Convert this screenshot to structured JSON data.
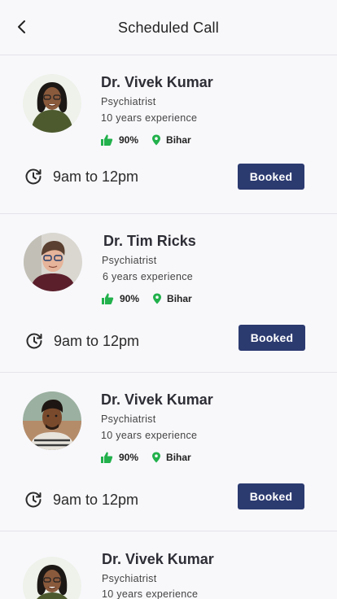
{
  "header": {
    "title": "Scheduled Call",
    "back_icon": "chevron-left-icon"
  },
  "colors": {
    "accent": "#2b3a6f",
    "rating_green": "#22b14c",
    "background": "#f8f8fb",
    "divider": "#e4e4ea"
  },
  "doctors": [
    {
      "name": "Dr. Vivek Kumar",
      "specialty": "Psychiatrist",
      "experience": "10 years experience",
      "rating": "90%",
      "location": "Bihar",
      "time": "9am to 12pm",
      "status_button": "Booked"
    },
    {
      "name": "Dr. Tim Ricks",
      "specialty": "Psychiatrist",
      "experience": "6 years experience",
      "rating": "90%",
      "location": "Bihar",
      "time": "9am to 12pm",
      "status_button": "Booked"
    },
    {
      "name": "Dr. Vivek Kumar",
      "specialty": "Psychiatrist",
      "experience": "10 years experience",
      "rating": "90%",
      "location": "Bihar",
      "time": "9am to 12pm",
      "status_button": "Booked"
    },
    {
      "name": "Dr. Vivek Kumar",
      "specialty": "Psychiatrist",
      "experience": "10 years experience"
    }
  ]
}
